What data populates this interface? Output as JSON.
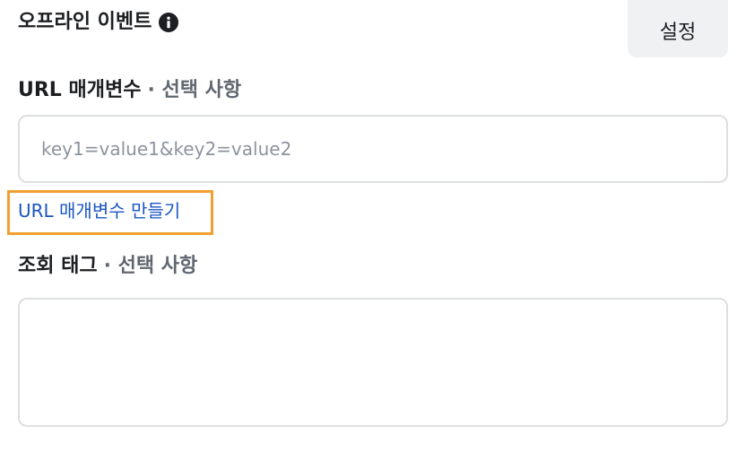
{
  "offline_events": {
    "title": "오프라인 이벤트",
    "info_icon": "info-icon",
    "settings_label": "설정"
  },
  "url_params": {
    "label": "URL 매개변수",
    "optional": "· 선택 사항",
    "placeholder": "key1=value1&key2=value2",
    "value": "",
    "create_link": "URL 매개변수 만들기"
  },
  "view_tags": {
    "label": "조회 태그",
    "optional": "· 선택 사항",
    "value": ""
  },
  "colors": {
    "link": "#1a56c2",
    "highlight": "#f0a030",
    "button_bg": "#f0f1f3",
    "border": "#dddfe2"
  }
}
